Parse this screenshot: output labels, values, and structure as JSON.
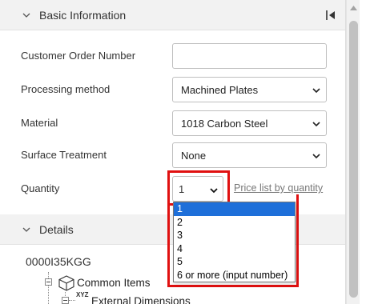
{
  "basic_section": {
    "title": "Basic Information"
  },
  "form": {
    "customer_order_label": "Customer Order Number",
    "customer_order_value": "",
    "processing_label": "Processing method",
    "processing_value": "Machined Plates",
    "material_label": "Material",
    "material_value": "1018 Carbon Steel",
    "surface_label": "Surface Treatment",
    "surface_value": "None",
    "quantity_label": "Quantity",
    "quantity_value": "1",
    "price_link": "Price list by quantity"
  },
  "quantity_dropdown": {
    "options": [
      "1",
      "2",
      "3",
      "4",
      "5",
      "6 or more (input number)"
    ],
    "selected": "1"
  },
  "details_section": {
    "title": "Details"
  },
  "tree": {
    "code": "0000I35KGG",
    "common_items": "Common Items",
    "xyz_badge": "XYZ",
    "external_dimensions": "External Dimensions"
  },
  "colors": {
    "highlight_border": "#e01010",
    "selected_option": "#1e6fd9"
  }
}
